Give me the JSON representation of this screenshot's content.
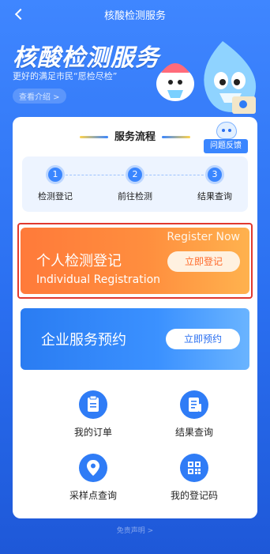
{
  "header": {
    "title": "核酸检测服务"
  },
  "hero": {
    "title": "核酸检测服务",
    "subtitle": "更好的满足市民“愿检尽检”",
    "intro_link": "查看介绍 >"
  },
  "feedback": {
    "label": "问题反馈"
  },
  "flow": {
    "title": "服务流程",
    "steps": [
      {
        "num": "1",
        "label": "检测登记"
      },
      {
        "num": "2",
        "label": "前往检测"
      },
      {
        "num": "3",
        "label": "结果查询"
      }
    ]
  },
  "registration": {
    "title": "个人检测登记",
    "title_en": "Individual Registration",
    "tag_en": "Register Now",
    "button": "立即登记"
  },
  "enterprise": {
    "title": "企业服务预约",
    "button": "立即预约"
  },
  "quick_links": [
    {
      "label": "我的订单",
      "icon": "clipboard-icon"
    },
    {
      "label": "结果查询",
      "icon": "document-icon"
    },
    {
      "label": "采样点查询",
      "icon": "location-pin-icon"
    },
    {
      "label": "我的登记码",
      "icon": "qr-code-icon"
    }
  ],
  "footer": {
    "disclaimer": "免责声明 >"
  },
  "colors": {
    "primary_blue": "#2a6ff0",
    "orange": "#ff7a3a",
    "highlight_red": "#e0392f"
  }
}
